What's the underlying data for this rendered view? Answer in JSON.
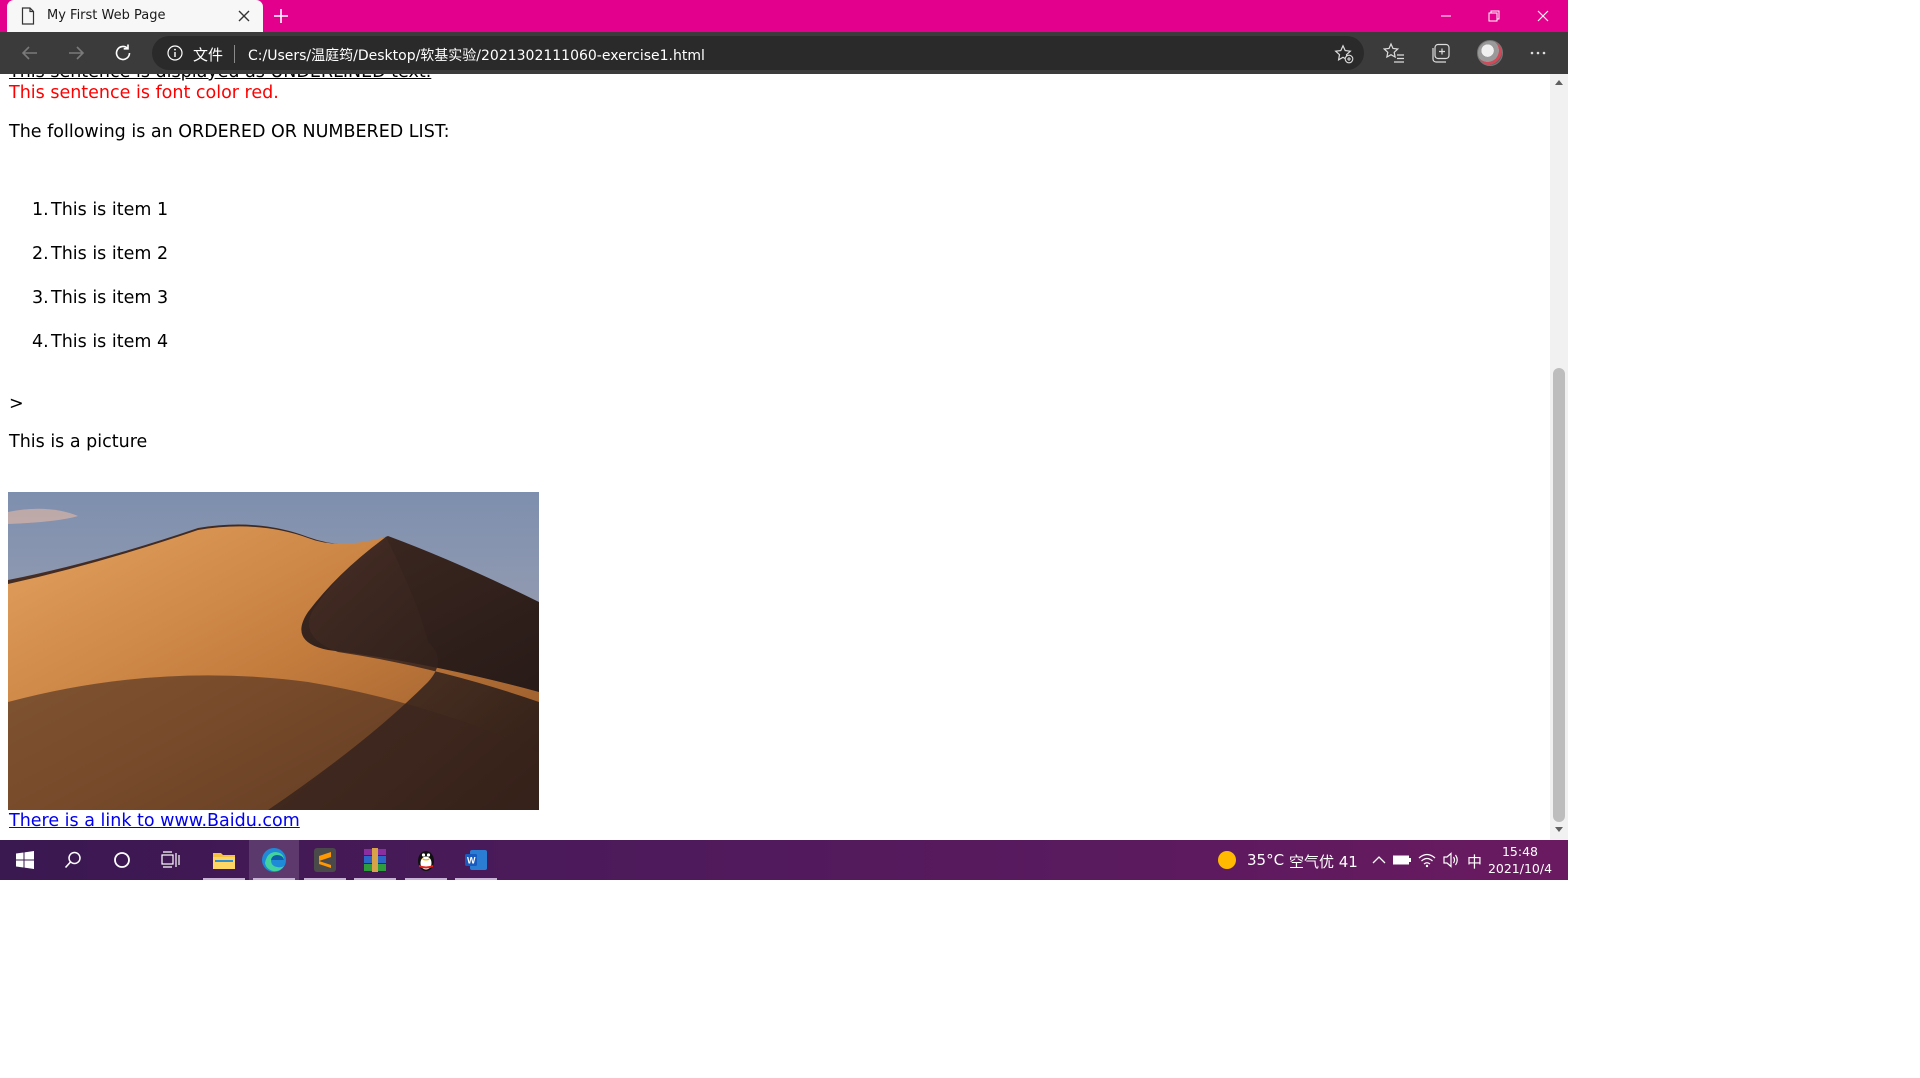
{
  "tab": {
    "title": "My First Web Page"
  },
  "address_bar": {
    "security_label": "文件",
    "url": "C:/Users/温庭筠/Desktop/软基实验/2021302111060-exercise1.html"
  },
  "page": {
    "underlined_text": "This sentence is displayed as UNDERLINED text.",
    "red_text": "This sentence is font color red.",
    "list_heading": "The following is an ORDERED OR NUMBERED LIST:",
    "list_items": [
      {
        "number": "1.",
        "text": "This is item 1"
      },
      {
        "number": "2.",
        "text": "This is item 2"
      },
      {
        "number": "3.",
        "text": "This is item 3"
      },
      {
        "number": "4.",
        "text": "This is item 4"
      }
    ],
    "stray_char": ">",
    "picture_caption": "This is a picture",
    "link_text": "There is a link to www.Baidu.com"
  },
  "taskbar": {
    "weather": {
      "temperature": "35°C",
      "air_quality": "空气优 41"
    },
    "ime": "中",
    "clock": {
      "time": "15:48",
      "date": "2021/10/4"
    }
  },
  "colors": {
    "titlebar": "#e3008c",
    "link": "#0000ee",
    "red_text": "#ff0000"
  }
}
